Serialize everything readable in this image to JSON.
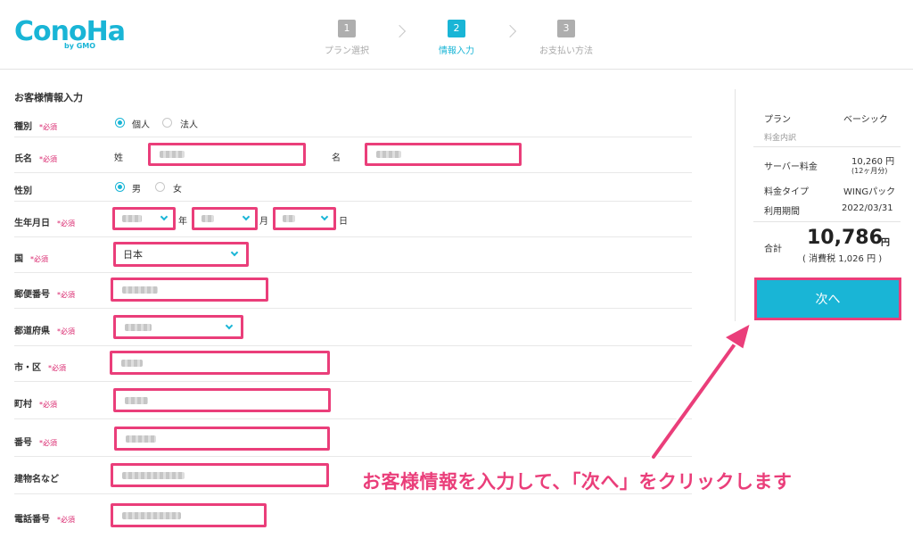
{
  "header": {
    "logo": "ConoHa",
    "logo_sub": "by GMO",
    "steps": [
      {
        "num": "1",
        "label": "プラン選択"
      },
      {
        "num": "2",
        "label": "情報入力"
      },
      {
        "num": "3",
        "label": "お支払い方法"
      }
    ]
  },
  "form": {
    "title": "お客様情報入力",
    "required": "*必須",
    "type": {
      "label": "種別",
      "opt1": "個人",
      "opt2": "法人"
    },
    "name": {
      "label": "氏名",
      "last": "姓",
      "first": "名"
    },
    "gender": {
      "label": "性別",
      "opt1": "男",
      "opt2": "女"
    },
    "birthday": {
      "label": "生年月日",
      "year": "年",
      "month": "月",
      "day": "日"
    },
    "country": {
      "label": "国",
      "value": "日本"
    },
    "postal": {
      "label": "郵便番号"
    },
    "prefecture": {
      "label": "都道府県"
    },
    "city": {
      "label": "市・区"
    },
    "town": {
      "label": "町村"
    },
    "number": {
      "label": "番号"
    },
    "building": {
      "label": "建物名など"
    },
    "phone": {
      "label": "電話番号"
    }
  },
  "summary": {
    "plan_label": "プラン",
    "plan_value": "ベーシック",
    "breakdown": "料金内訳",
    "server_label": "サーバー料金",
    "server_value": "10,260 円",
    "server_note": "(12ヶ月分)",
    "type_label": "料金タイプ",
    "type_value": "WINGパック",
    "period_label": "利用期間",
    "period_value": "2022/03/31",
    "total_label": "合計",
    "total_value": "10,786",
    "yen": "円",
    "tax": "( 消費税 1,026 円 )",
    "next": "次へ"
  },
  "annotation": "お客様情報を入力して、「次へ」をクリックします",
  "colors": {
    "accent": "#19b5d6",
    "highlight": "#ea3e7a"
  }
}
